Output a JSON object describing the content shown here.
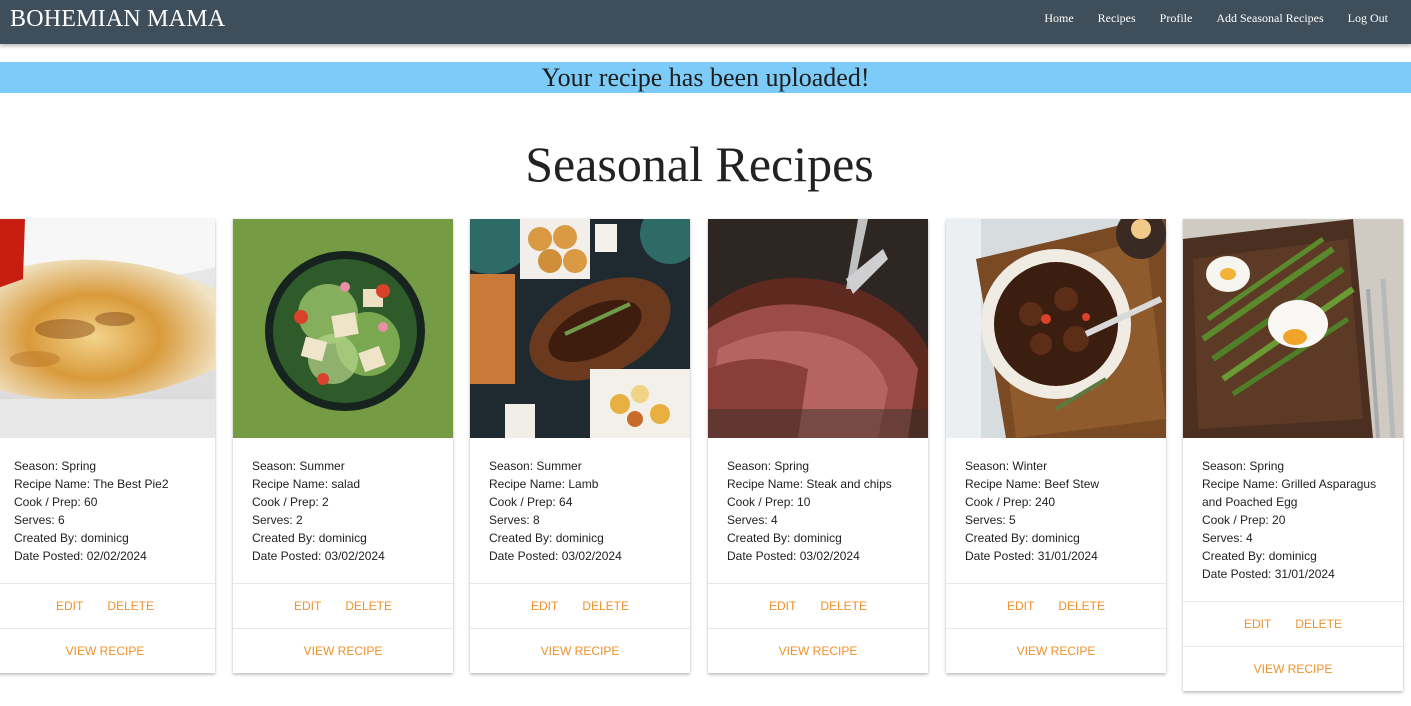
{
  "navbar": {
    "brand": "BOHEMIAN MAMA",
    "links": [
      "Home",
      "Recipes",
      "Profile",
      "Add Seasonal Recipes",
      "Log Out"
    ]
  },
  "flash": {
    "message": "Your recipe has been uploaded!"
  },
  "page": {
    "title": "Seasonal Recipes"
  },
  "labels": {
    "season": "Season:",
    "recipe_name": "Recipe Name:",
    "cook_prep": "Cook / Prep:",
    "serves": "Serves:",
    "created_by": "Created By:",
    "date_posted": "Date Posted:",
    "edit": "EDIT",
    "delete": "DELETE",
    "view": "VIEW RECIPE"
  },
  "colors": {
    "navbar": "#3e4f5b",
    "flash": "#7ccbf8",
    "action": "#f0912b"
  },
  "recipes": [
    {
      "season": "Spring",
      "name": "The Best Pie2",
      "cook_prep": "60",
      "serves": "6",
      "created_by": "dominicg",
      "date_posted": "02/02/2024",
      "image": "pie-photo"
    },
    {
      "season": "Summer",
      "name": "salad",
      "cook_prep": "2",
      "serves": "2",
      "created_by": "dominicg",
      "date_posted": "03/02/2024",
      "image": "salad-photo"
    },
    {
      "season": "Summer",
      "name": "Lamb",
      "cook_prep": "64",
      "serves": "8",
      "created_by": "dominicg",
      "date_posted": "03/02/2024",
      "image": "lamb-photo"
    },
    {
      "season": "Spring",
      "name": "Steak and chips",
      "cook_prep": "10",
      "serves": "4",
      "created_by": "dominicg",
      "date_posted": "03/02/2024",
      "image": "steak-photo"
    },
    {
      "season": "Winter",
      "name": "Beef Stew",
      "cook_prep": "240",
      "serves": "5",
      "created_by": "dominicg",
      "date_posted": "31/01/2024",
      "image": "stew-photo"
    },
    {
      "season": "Spring",
      "name": "Grilled Asparagus and Poached Egg",
      "cook_prep": "20",
      "serves": "4",
      "created_by": "dominicg",
      "date_posted": "31/01/2024",
      "image": "asparagus-photo"
    }
  ]
}
